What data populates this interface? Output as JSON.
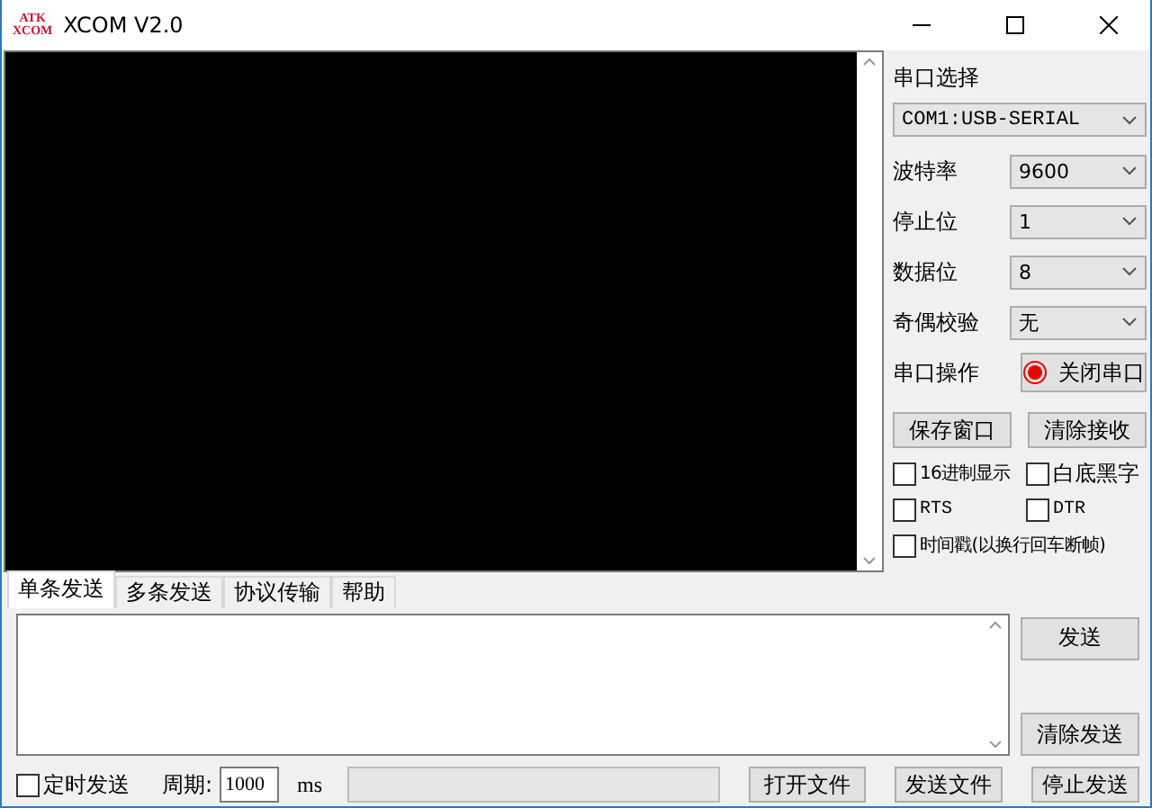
{
  "window": {
    "title": "XCOM V2.0",
    "logo": "ATK\nXCOM"
  },
  "port_select": {
    "label": "串口选择",
    "value": "COM1:USB-SERIAL"
  },
  "settings": [
    {
      "label": "波特率",
      "value": "9600"
    },
    {
      "label": "停止位",
      "value": "1"
    },
    {
      "label": "数据位",
      "value": "8"
    },
    {
      "label": "奇偶校验",
      "value": "无"
    }
  ],
  "port_operation": {
    "label": "串口操作",
    "button": "关闭串口",
    "open": true
  },
  "receive_buttons": [
    "保存窗口",
    "清除接收"
  ],
  "options": [
    {
      "label": "16进制显示",
      "checked": false
    },
    {
      "label": "白底黑字",
      "checked": false
    },
    {
      "label": "RTS",
      "checked": false
    },
    {
      "label": "DTR",
      "checked": false
    },
    {
      "label": "时间戳(以换行回车断帧)",
      "checked": false
    }
  ],
  "tabs": [
    {
      "label": "单条发送",
      "selected": true
    },
    {
      "label": "多条发送",
      "selected": false
    },
    {
      "label": "协议传输",
      "selected": false
    },
    {
      "label": "帮助",
      "selected": false
    }
  ],
  "send_buttons": [
    "发送",
    "清除发送"
  ],
  "bottom": {
    "timed_send": {
      "label": "定时发送",
      "checked": false
    },
    "period_label": "周期:",
    "period_value": "1000",
    "unit": "ms",
    "progress": {
      "level": 0
    },
    "buttons": [
      "打开文件",
      "发送文件",
      "停止发送"
    ]
  }
}
